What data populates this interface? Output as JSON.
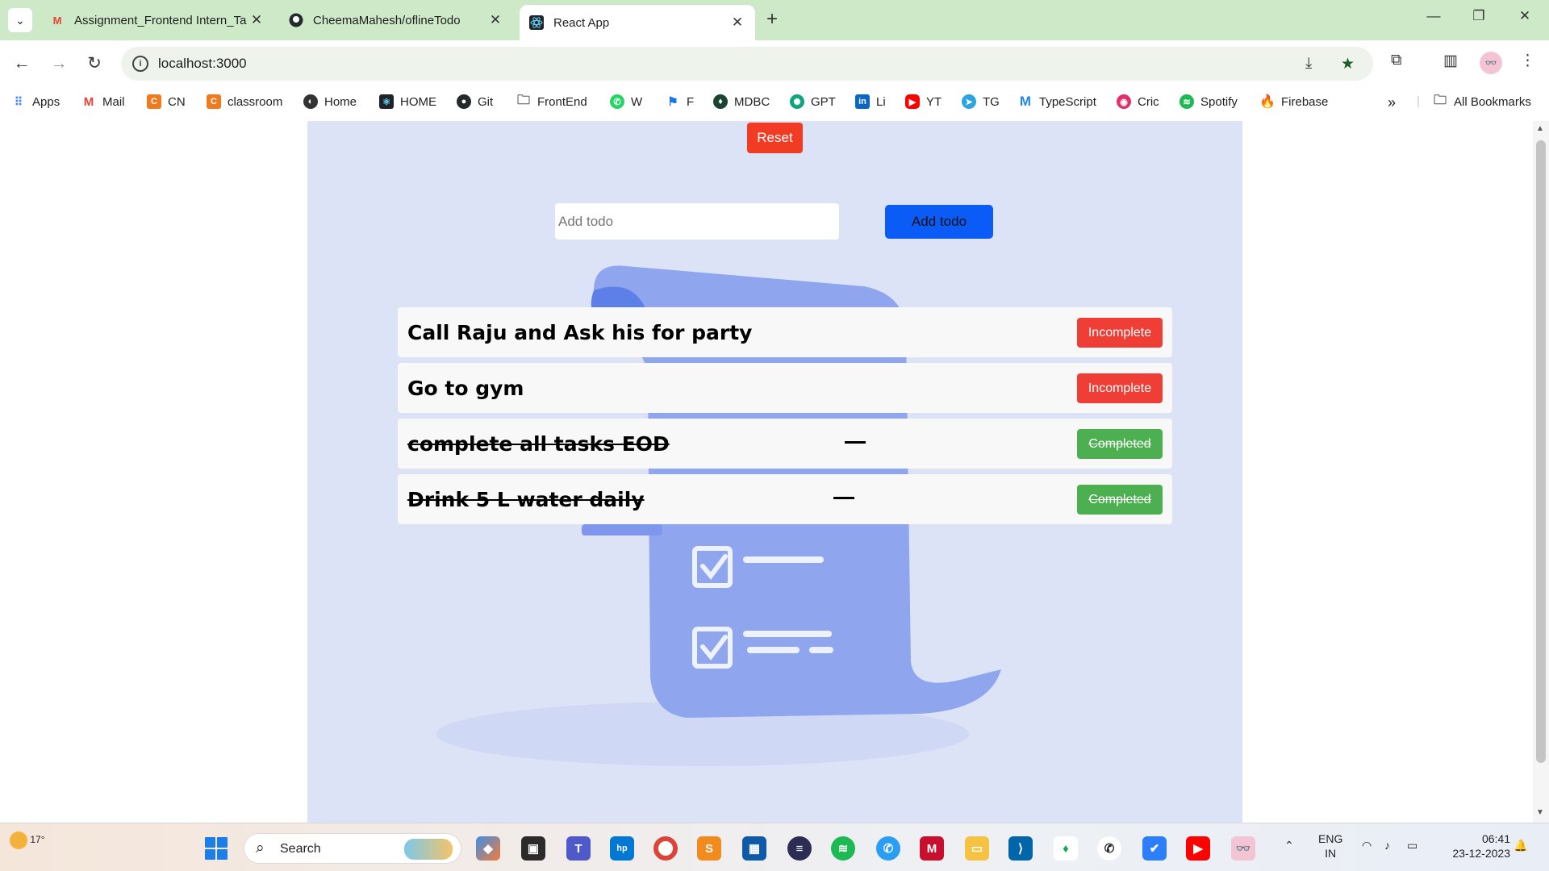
{
  "browser": {
    "tabs": [
      {
        "title": "Assignment_Frontend Intern_Ta",
        "icon": "gmail-icon",
        "active": false
      },
      {
        "title": "CheemaMahesh/oflineTodo",
        "icon": "github-icon",
        "active": false
      },
      {
        "title": "React App",
        "icon": "react-icon",
        "active": true
      }
    ],
    "url": "localhost:3000",
    "bookmarks": [
      {
        "label": "Apps",
        "icon": "apps-grid-icon",
        "color": "#4285f4"
      },
      {
        "label": "Mail",
        "icon": "gmail-icon",
        "color": "#ea4335"
      },
      {
        "label": "CN",
        "icon": "cn-icon",
        "color": "#f07a1e"
      },
      {
        "label": "classroom",
        "icon": "cn-icon",
        "color": "#f07a1e"
      },
      {
        "label": "Home",
        "icon": "globe-icon",
        "color": "#333333"
      },
      {
        "label": "HOME",
        "icon": "react-icon",
        "color": "#20232a"
      },
      {
        "label": "Git",
        "icon": "github-icon",
        "color": "#24292e"
      },
      {
        "label": "FrontEnd",
        "icon": "folder-icon",
        "color": "#555555"
      },
      {
        "label": "W",
        "icon": "whatsapp-icon",
        "color": "#25d366"
      },
      {
        "label": "F",
        "icon": "flag-icon",
        "color": "#1a73e8"
      },
      {
        "label": "MDBC",
        "icon": "mongodb-icon",
        "color": "#1b4332"
      },
      {
        "label": "GPT",
        "icon": "openai-icon",
        "color": "#10a37f"
      },
      {
        "label": "Li",
        "icon": "linkedin-icon",
        "color": "#0a66c2"
      },
      {
        "label": "YT",
        "icon": "youtube-icon",
        "color": "#ff0000"
      },
      {
        "label": "TG",
        "icon": "telegram-icon",
        "color": "#2aa5e0"
      },
      {
        "label": "TypeScript",
        "icon": "m-icon",
        "color": "#1e88e5"
      },
      {
        "label": "Cric",
        "icon": "cric-icon",
        "color": "#e1306c"
      },
      {
        "label": "Spotify",
        "icon": "spotify-icon",
        "color": "#1db954"
      },
      {
        "label": "Firebase",
        "icon": "firebase-icon",
        "color": "#ffa000"
      }
    ],
    "all_bookmarks_label": "All Bookmarks"
  },
  "app": {
    "reset_label": "Reset",
    "input_placeholder": "Add todo",
    "add_label": "Add todo",
    "todos": [
      {
        "text": "Call Raju and Ask his for party",
        "status": "Incomplete",
        "done": false
      },
      {
        "text": "Go to gym",
        "status": "Incomplete",
        "done": false
      },
      {
        "text": "complete all tasks EOD",
        "status": "Completed",
        "done": true
      },
      {
        "text": "Drink 5 L water daily",
        "status": "Completed",
        "done": true
      }
    ],
    "colors": {
      "reset": "#f13b22",
      "add": "#0b5cf7",
      "incomplete": "#ef3e35",
      "completed": "#4caf50",
      "background": "#dde3f6"
    }
  },
  "taskbar": {
    "weather": "17°",
    "search_label": "Search",
    "lang_line1": "ENG",
    "lang_line2": "IN",
    "time": "06:41",
    "date": "23-12-2023"
  }
}
